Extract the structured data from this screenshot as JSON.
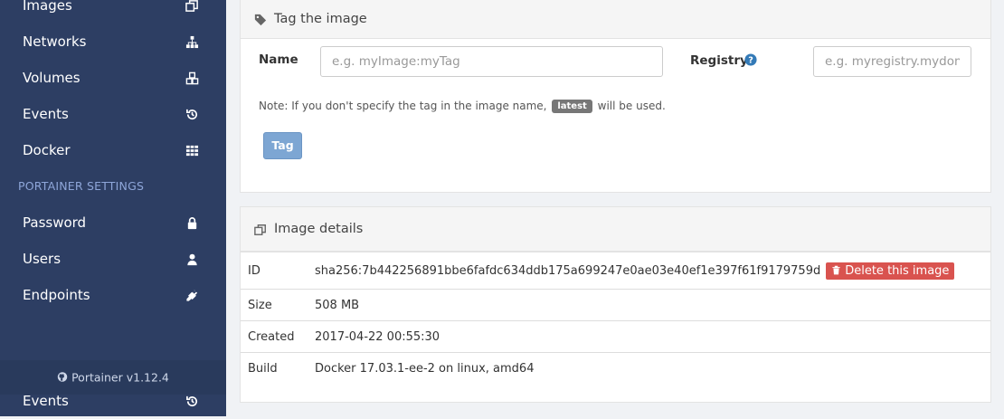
{
  "sidebar": {
    "items_top": [
      {
        "label": "Images",
        "icon": "clone-icon"
      },
      {
        "label": "Networks",
        "icon": "sitemap-icon"
      },
      {
        "label": "Volumes",
        "icon": "cubes-icon"
      },
      {
        "label": "Events",
        "icon": "history-icon"
      },
      {
        "label": "Docker",
        "icon": "grid-icon"
      }
    ],
    "section_title": "PORTAINER SETTINGS",
    "items_settings": [
      {
        "label": "Password",
        "icon": "lock-icon"
      },
      {
        "label": "Users",
        "icon": "user-icon"
      },
      {
        "label": "Endpoints",
        "icon": "plug-icon"
      }
    ],
    "footer_version": "Portainer v1.12.4",
    "bottom_item": {
      "label": "Events",
      "icon": "history-icon"
    }
  },
  "tag_panel": {
    "title": "Tag the image",
    "name_label": "Name",
    "name_placeholder": "e.g. myImage:myTag",
    "registry_label": "Registry",
    "registry_placeholder": "e.g. myregistry.mydomain",
    "note_prefix": "Note: If you don't specify the tag in the image name,",
    "note_badge": "latest",
    "note_suffix": "will be used.",
    "tag_button": "Tag"
  },
  "details_panel": {
    "title": "Image details",
    "rows": {
      "id": {
        "key": "ID",
        "value": "sha256:7b442256891bbe6fafdc634ddb175a699247e0ae03e40ef1e397f61f9179759d",
        "action": "Delete this image"
      },
      "size": {
        "key": "Size",
        "value": "508 MB"
      },
      "created": {
        "key": "Created",
        "value": "2017-04-22 00:55:30"
      },
      "build": {
        "key": "Build",
        "value": "Docker 17.03.1-ee-2 on linux, amd64"
      }
    }
  },
  "colors": {
    "sidebar_bg": "#2d3e63",
    "section_title": "#8ea6d9",
    "primary_button": "#7da6d3",
    "danger_button": "#d9534f",
    "help_icon": "#337ab7"
  }
}
